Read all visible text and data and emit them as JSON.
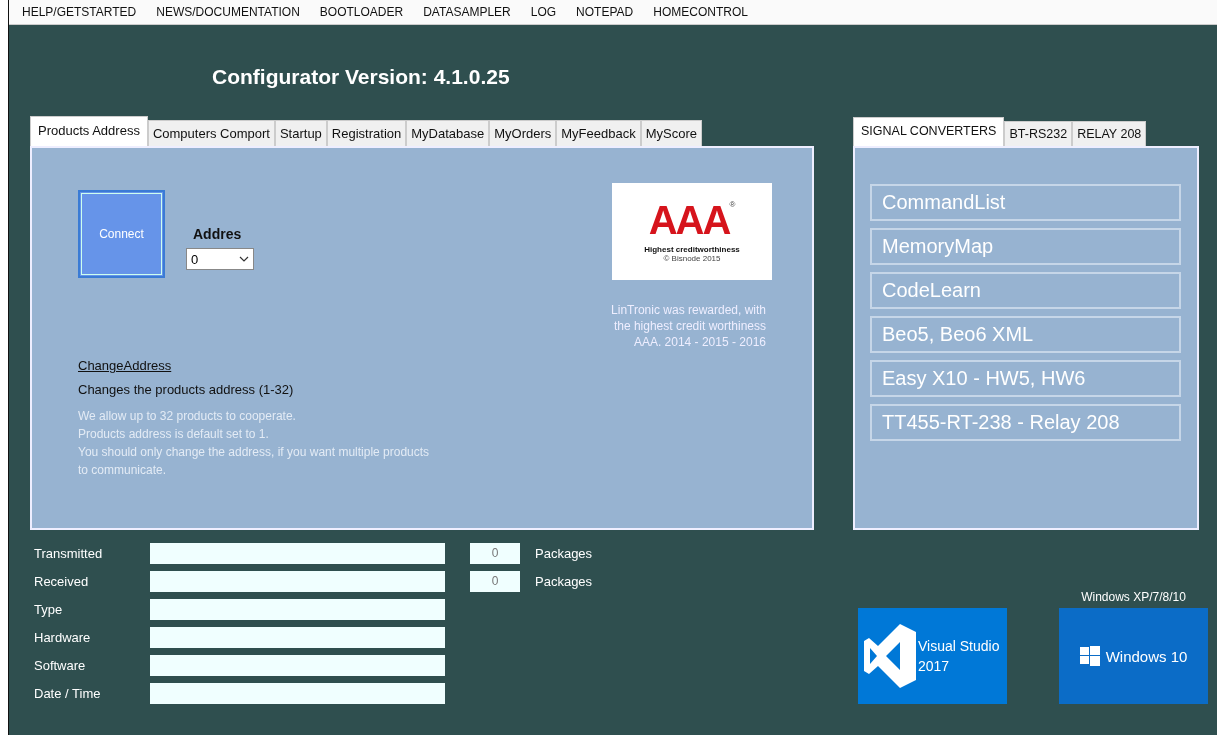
{
  "menu": [
    "HELP/GETSTARTED",
    "NEWS/DOCUMENTATION",
    "BOOTLOADER",
    "DATASAMPLER",
    "LOG",
    "NOTEPAD",
    "HOMECONTROL"
  ],
  "title": "Configurator Version: 4.1.0.25",
  "left_tabs": [
    {
      "label": "Products Address",
      "selected": true
    },
    {
      "label": "Computers Comport",
      "selected": false
    },
    {
      "label": "Startup",
      "selected": false
    },
    {
      "label": "Registration",
      "selected": false
    },
    {
      "label": "MyDatabase",
      "selected": false
    },
    {
      "label": "MyOrders",
      "selected": false
    },
    {
      "label": "MyFeedback",
      "selected": false
    },
    {
      "label": "MyScore",
      "selected": false
    }
  ],
  "connect_button": "Connect",
  "address": {
    "label": "Addres",
    "value": "0"
  },
  "badge": {
    "mark": "AAA",
    "registered": "®",
    "caption": "Highest creditworthiness",
    "copyright": "© Bisnode 2015"
  },
  "award_text": "LinTronic was rewarded, with\nthe highest credit worthiness\nAAA. 2014 - 2015 - 2016",
  "change_address": {
    "link": "ChangeAddress",
    "description": "Changes the products address (1-32)",
    "info": "We allow up to 32 products to cooperate.\nProducts address is default set to 1.\nYou should only change the address, if you want multiple products\nto communicate."
  },
  "right_tabs": [
    {
      "label": "SIGNAL CONVERTERS",
      "selected": true
    },
    {
      "label": "BT-RS232",
      "selected": false
    },
    {
      "label": "RELAY 208",
      "selected": false
    }
  ],
  "converter_buttons": [
    "CommandList",
    "MemoryMap",
    "CodeLearn",
    "Beo5, Beo6 XML",
    "Easy X10 - HW5, HW6",
    "TT455-RT-238 - Relay 208"
  ],
  "stats": [
    {
      "label": "Transmitted",
      "count": "0",
      "unit": "Packages"
    },
    {
      "label": "Received",
      "count": "0",
      "unit": "Packages"
    },
    {
      "label": "Type"
    },
    {
      "label": "Hardware"
    },
    {
      "label": "Software"
    },
    {
      "label": "Date / Time"
    }
  ],
  "visual_studio": {
    "name": "Visual Studio",
    "version": "2017"
  },
  "windows": {
    "caption": "Windows XP/7/8/10",
    "name": "Windows 10"
  }
}
